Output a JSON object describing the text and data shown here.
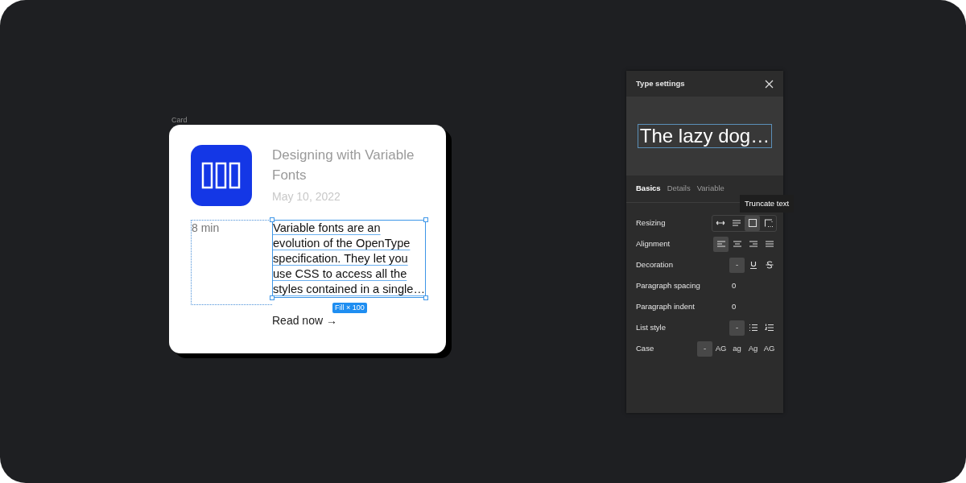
{
  "card": {
    "frame_label": "Card",
    "title": "Designing with Variable Fonts",
    "date": "May 10, 2022",
    "duration": "8 min",
    "body": "Variable fonts are an evolution of the OpenType specification. They let you use CSS to access all the styles contained in a single…",
    "size_badge": "Fill × 100",
    "link": "Read now →"
  },
  "panel": {
    "title": "Type settings",
    "preview": "The lazy dog…",
    "tabs": [
      {
        "label": "Basics",
        "selected": true
      },
      {
        "label": "Details",
        "selected": false
      },
      {
        "label": "Variable",
        "selected": false
      }
    ],
    "tooltip": "Truncate text",
    "rows": [
      {
        "label": "Resizing",
        "kind": "resizing",
        "options": [
          {
            "selected": false
          },
          {
            "selected": false
          },
          {
            "selected": true
          },
          {
            "selected": false
          }
        ]
      },
      {
        "label": "Alignment",
        "kind": "alignment",
        "options": [
          {
            "selected": true
          },
          {
            "selected": false
          },
          {
            "selected": false
          },
          {
            "selected": false
          }
        ]
      },
      {
        "label": "Decoration",
        "kind": "decoration",
        "options": [
          {
            "label": "-",
            "selected": true
          },
          {
            "selected": false
          },
          {
            "selected": false
          }
        ]
      },
      {
        "label": "Paragraph spacing",
        "kind": "value",
        "value": "0"
      },
      {
        "label": "Paragraph indent",
        "kind": "value",
        "value": "0"
      },
      {
        "label": "List style",
        "kind": "list",
        "options": [
          {
            "label": "-",
            "selected": true
          },
          {
            "selected": false
          },
          {
            "selected": false
          }
        ]
      },
      {
        "label": "Case",
        "kind": "case",
        "options": [
          {
            "label": "-",
            "selected": true
          },
          {
            "label": "AG",
            "selected": false
          },
          {
            "label": "ag",
            "selected": false
          },
          {
            "label": "Ag",
            "selected": false
          },
          {
            "label": "AG",
            "selected": false
          }
        ]
      }
    ]
  }
}
